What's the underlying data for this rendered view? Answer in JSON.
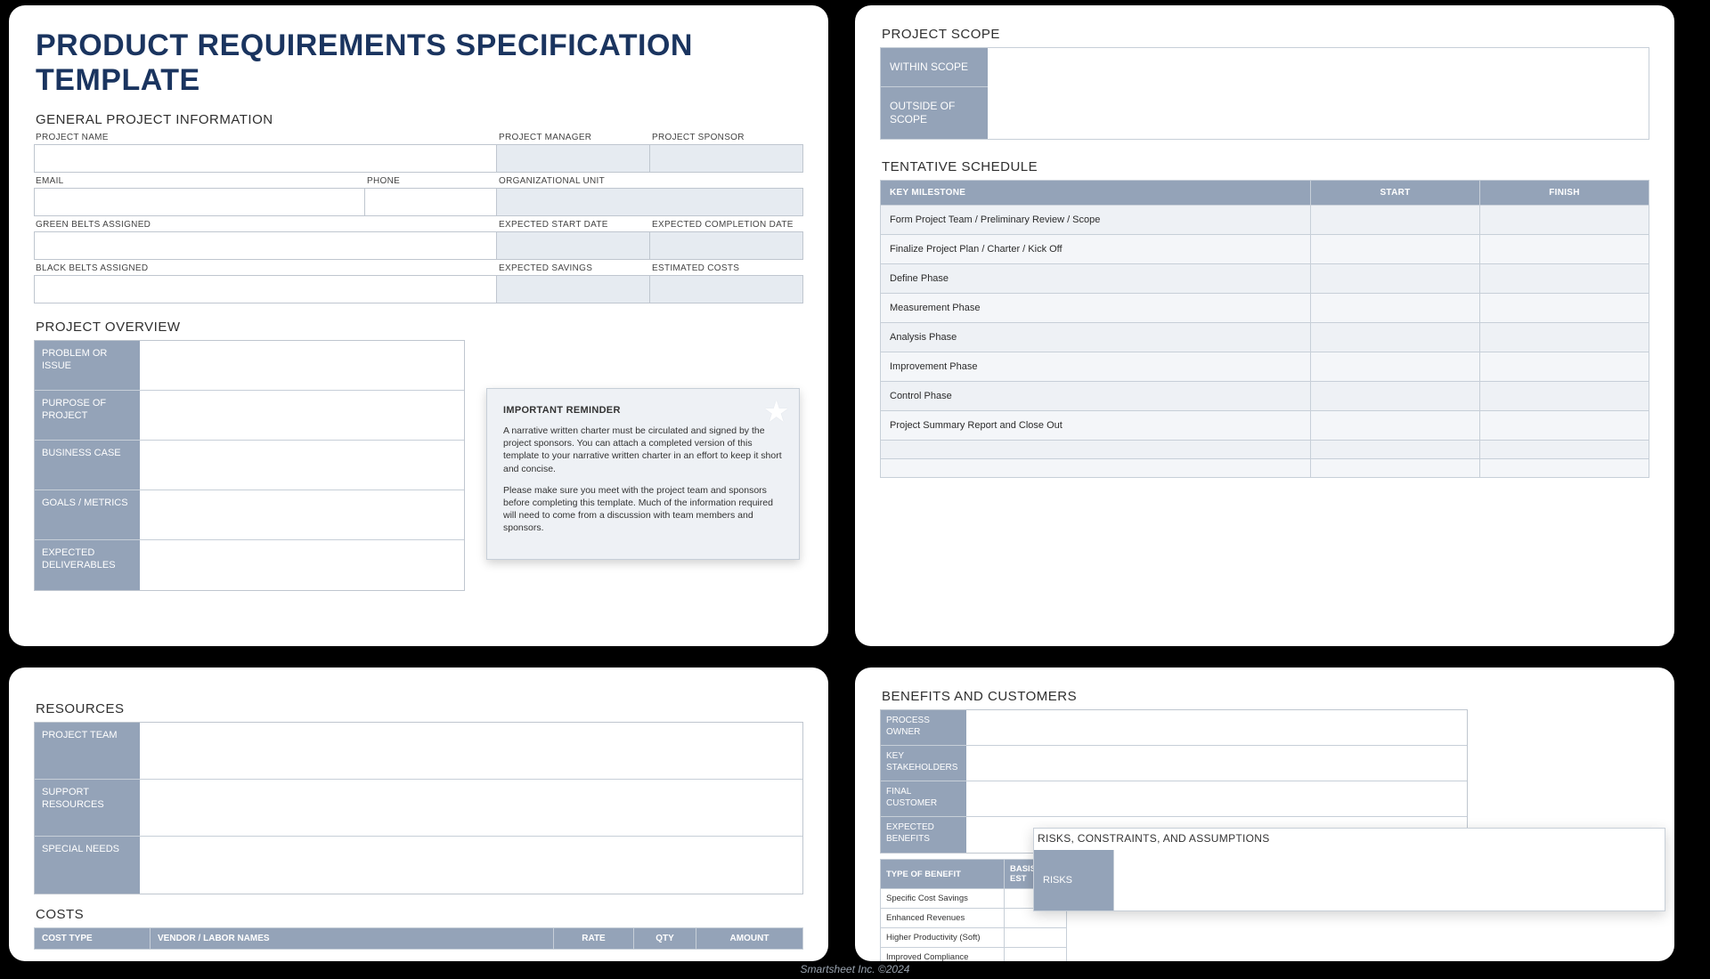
{
  "title": "PRODUCT REQUIREMENTS SPECIFICATION TEMPLATE",
  "footer": "Smartsheet Inc. ©2024",
  "general": {
    "heading": "GENERAL PROJECT INFORMATION",
    "labels": {
      "project_name": "PROJECT NAME",
      "project_manager": "PROJECT MANAGER",
      "project_sponsor": "PROJECT SPONSOR",
      "email": "EMAIL",
      "phone": "PHONE",
      "org_unit": "ORGANIZATIONAL UNIT",
      "green_belts": "GREEN BELTS ASSIGNED",
      "expected_start": "EXPECTED START DATE",
      "expected_completion": "EXPECTED COMPLETION DATE",
      "black_belts": "BLACK BELTS ASSIGNED",
      "expected_savings": "EXPECTED SAVINGS",
      "estimated_costs": "ESTIMATED COSTS"
    }
  },
  "overview": {
    "heading": "PROJECT OVERVIEW",
    "rows": {
      "problem": "PROBLEM OR ISSUE",
      "purpose": "PURPOSE OF PROJECT",
      "business_case": "BUSINESS CASE",
      "goals": "GOALS / METRICS",
      "deliverables": "EXPECTED DELIVERABLES"
    }
  },
  "reminder": {
    "heading": "IMPORTANT REMINDER",
    "p1": "A narrative written charter must be circulated and signed by the project sponsors. You can attach a completed version of this template to your narrative written charter in an effort to keep it short and concise.",
    "p2": "Please make sure you meet with the project team and sponsors before completing this template. Much of the information required will need to come from a discussion with team members and sponsors."
  },
  "scope": {
    "heading": "PROJECT SCOPE",
    "within": "WITHIN SCOPE",
    "outside": "OUTSIDE OF SCOPE"
  },
  "schedule": {
    "heading": "TENTATIVE SCHEDULE",
    "cols": {
      "milestone": "KEY MILESTONE",
      "start": "START",
      "finish": "FINISH"
    },
    "rows": [
      "Form Project Team / Preliminary Review / Scope",
      "Finalize Project Plan / Charter / Kick Off",
      "Define Phase",
      "Measurement Phase",
      "Analysis Phase",
      "Improvement Phase",
      "Control Phase",
      "Project Summary Report and Close Out",
      "",
      ""
    ]
  },
  "resources": {
    "heading": "RESOURCES",
    "rows": {
      "team": "PROJECT TEAM",
      "support": "SUPPORT RESOURCES",
      "special": "SPECIAL NEEDS"
    }
  },
  "costs": {
    "heading": "COSTS",
    "cols": {
      "cost_type": "COST TYPE",
      "vendor": "VENDOR / LABOR NAMES",
      "rate": "RATE",
      "qty": "QTY",
      "amount": "AMOUNT"
    }
  },
  "benefits": {
    "heading": "BENEFITS AND CUSTOMERS",
    "rows": {
      "owner": "PROCESS OWNER",
      "stakeholders": "KEY STAKEHOLDERS",
      "final_customer": "FINAL CUSTOMER",
      "expected_benefits": "EXPECTED BENEFITS"
    },
    "type_cols": {
      "type": "TYPE OF BENEFIT",
      "basis": "BASIS OF EST"
    },
    "type_rows": [
      "Specific Cost Savings",
      "Enhanced Revenues",
      "Higher Productivity (Soft)",
      "Improved Compliance"
    ]
  },
  "risks": {
    "heading": "RISKS, CONSTRAINTS, AND ASSUMPTIONS",
    "row1": "RISKS"
  }
}
